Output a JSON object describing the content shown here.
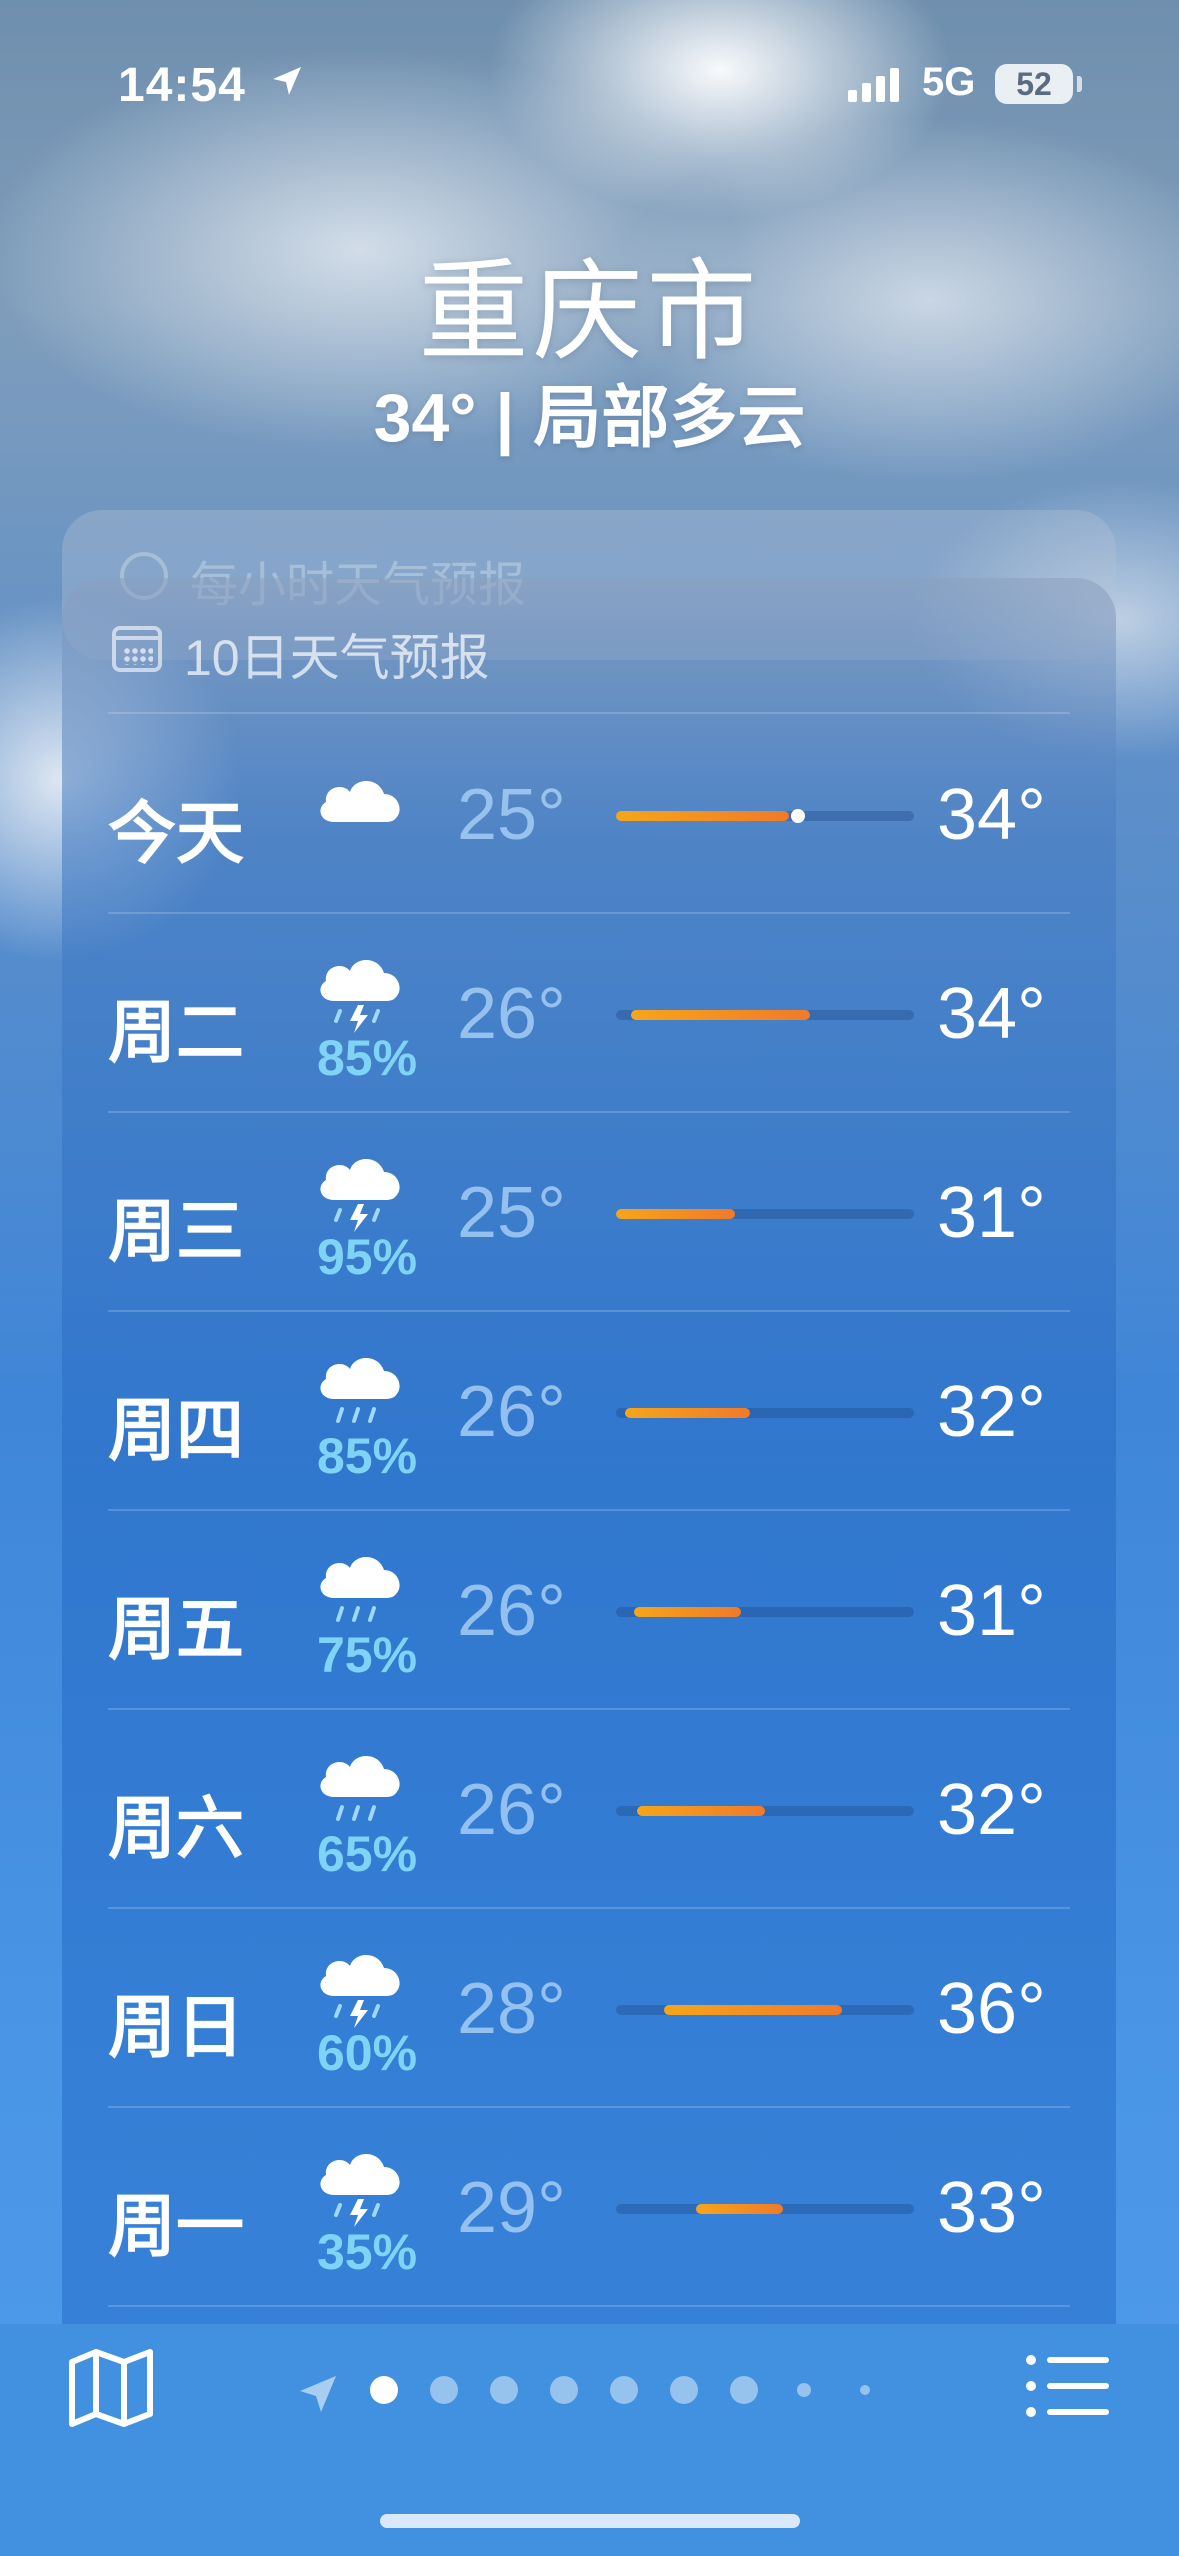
{
  "status_bar": {
    "time": "14:54",
    "network": "5G",
    "battery": "52"
  },
  "header": {
    "city": "重庆市",
    "current": "34° | 局部多云"
  },
  "hourly_card": {
    "label": "每小时天气预报"
  },
  "forecast": {
    "title": "10日天气预报",
    "days": [
      {
        "day": "今天",
        "icon": "cloud-icon",
        "precip": "",
        "low": "25°",
        "high": "34°",
        "bar": [
          0.0,
          0.58
        ],
        "current": 0.61
      },
      {
        "day": "周二",
        "icon": "thunderstorm-icon",
        "precip": "85%",
        "low": "26°",
        "high": "34°",
        "bar": [
          0.05,
          0.65
        ]
      },
      {
        "day": "周三",
        "icon": "thunderstorm-icon",
        "precip": "95%",
        "low": "25°",
        "high": "31°",
        "bar": [
          0.0,
          0.4
        ]
      },
      {
        "day": "周四",
        "icon": "rain-icon",
        "precip": "85%",
        "low": "26°",
        "high": "32°",
        "bar": [
          0.03,
          0.45
        ]
      },
      {
        "day": "周五",
        "icon": "rain-icon",
        "precip": "75%",
        "low": "26°",
        "high": "31°",
        "bar": [
          0.06,
          0.42
        ]
      },
      {
        "day": "周六",
        "icon": "rain-icon",
        "precip": "65%",
        "low": "26°",
        "high": "32°",
        "bar": [
          0.07,
          0.5
        ]
      },
      {
        "day": "周日",
        "icon": "thunderstorm-icon",
        "precip": "60%",
        "low": "28°",
        "high": "36°",
        "bar": [
          0.16,
          0.76
        ]
      },
      {
        "day": "周一",
        "icon": "thunderstorm-icon",
        "precip": "35%",
        "low": "29°",
        "high": "33°",
        "bar": [
          0.27,
          0.56
        ]
      }
    ]
  },
  "bottom_bar": {
    "page_count": 9,
    "active_page": 0
  },
  "colors": {
    "bar_start": "#f6a51a",
    "bar_end": "#f07a2a",
    "precip": "#7fd3f5"
  }
}
